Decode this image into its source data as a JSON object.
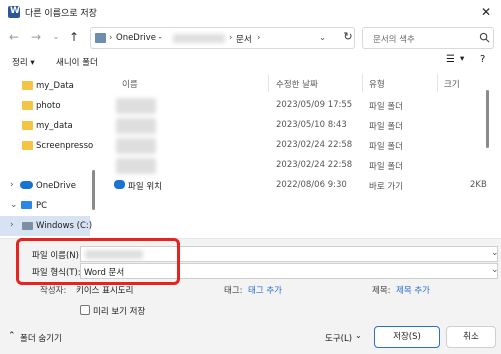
{
  "window": {
    "title": "다른 이름으로 저장"
  },
  "address": {
    "breadcrumbs": [
      "OneDrive -",
      "문서"
    ],
    "search_placeholder": "문서의 색추"
  },
  "commands": {
    "organize": "정리 ▾",
    "new_folder": "새니이 폴더"
  },
  "nav": {
    "items": [
      {
        "label": "my_Data"
      },
      {
        "label": "photo"
      },
      {
        "label": "my_data"
      },
      {
        "label": "Screenpresso"
      },
      {
        "label": "OneDrive"
      },
      {
        "label": "PC"
      },
      {
        "label": "Windows (C:)"
      }
    ]
  },
  "columns": {
    "name": "이름",
    "date": "수정한 날짜",
    "type": "유형",
    "size": "크기"
  },
  "files": [
    {
      "date": "2023/05/09 17:55",
      "type": "파일 폴더",
      "size": ""
    },
    {
      "date": "2023/05/10 8:43",
      "type": "파일 폴더",
      "size": ""
    },
    {
      "date": "2023/02/24 22:58",
      "type": "파일 폴더",
      "size": ""
    },
    {
      "date": "2023/02/24 22:58",
      "type": "파일 폴더",
      "size": ""
    },
    {
      "name": "파일 위치",
      "date": "2022/08/06 9:30",
      "type": "바로 가기",
      "size": "2KB"
    }
  ],
  "form": {
    "filename_label": "파일 이름(N):",
    "filetype_label": "파일 형식(T):",
    "filetype_value": "Word 문서",
    "author_label": "작성자:",
    "author_value": "키이스 표시도리",
    "tags_label": "태그:",
    "tags_value": "태그 추가",
    "title_label": "제목:",
    "title_value": "제목 추가",
    "thumbnail_label": "미리 보기 저장"
  },
  "footer": {
    "hide_folders": "폴더 숨기기",
    "tools": "도구(L)",
    "save": "저장(S)",
    "cancel": "취소"
  }
}
